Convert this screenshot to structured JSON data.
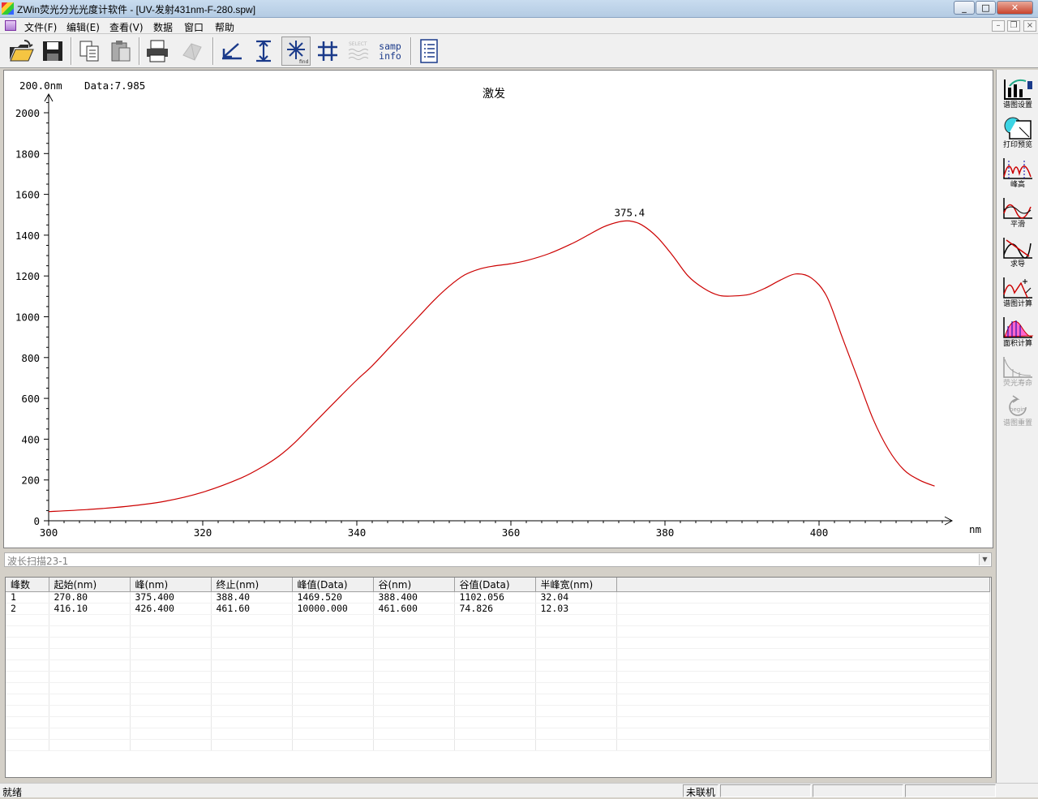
{
  "window": {
    "title": "ZWin荧光分光光度计软件 - [UV-发射431nm-F-280.spw]",
    "minimize": "_",
    "maximize": "□",
    "close": "✕"
  },
  "menubar": {
    "items": [
      "文件(F)",
      "编辑(E)",
      "查看(V)",
      "数据",
      "窗口",
      "帮助"
    ],
    "mdi_minimize": "–",
    "mdi_restore": "❐",
    "mdi_close": "×"
  },
  "toolbar": {
    "icons": [
      "open-folder-icon",
      "save-icon",
      "copy-icon",
      "paste-icon",
      "print-icon",
      "3d-view-icon",
      "undo-zoom-icon",
      "vertical-scale-icon",
      "peak-find-icon",
      "grid-icon",
      "select-icon",
      "samp-info-icon",
      "report-icon"
    ],
    "select_label": "SELECT",
    "samp_label": "samp",
    "info_label": "info",
    "find_label": "find"
  },
  "plot": {
    "cursor_text": "200.0nm",
    "data_text": "Data:7.985",
    "title": "激发",
    "x_unit": "nm",
    "peak_label": "375.4",
    "line_color": "#cc0000"
  },
  "chart_data": {
    "type": "line",
    "title": "激发",
    "xlabel": "nm",
    "ylabel": "",
    "xlim": [
      300,
      418
    ],
    "ylim": [
      0,
      2100
    ],
    "x_ticks": [
      300,
      320,
      340,
      360,
      380,
      400
    ],
    "y_ticks": [
      0,
      200,
      400,
      600,
      800,
      1000,
      1200,
      1400,
      1600,
      1800,
      2000
    ],
    "grid": false,
    "series": [
      {
        "x": [
          300,
          305,
          310,
          315,
          320,
          325,
          328,
          330,
          332,
          335,
          338,
          340,
          342,
          345,
          348,
          350,
          352,
          354,
          356,
          358,
          360,
          362,
          365,
          368,
          370,
          372,
          374,
          375.4,
          377,
          379,
          381,
          383,
          385,
          387,
          389,
          391,
          393,
          395,
          397,
          399,
          401,
          403,
          405,
          407,
          409,
          411,
          413,
          415
        ],
        "y": [
          45,
          55,
          70,
          95,
          140,
          210,
          270,
          320,
          385,
          500,
          615,
          690,
          760,
          880,
          1000,
          1080,
          1150,
          1205,
          1235,
          1250,
          1260,
          1275,
          1310,
          1360,
          1400,
          1440,
          1465,
          1469.5,
          1450,
          1390,
          1300,
          1200,
          1140,
          1105,
          1102,
          1110,
          1140,
          1180,
          1210,
          1190,
          1100,
          900,
          700,
          500,
          350,
          250,
          200,
          170
        ]
      }
    ],
    "annotations": [
      {
        "x": 375.4,
        "y": 1469.5,
        "text": "375.4"
      }
    ]
  },
  "right_panel": {
    "buttons": [
      {
        "label": "谱图设置",
        "icon": "spectrum-settings-icon",
        "enabled": true
      },
      {
        "label": "打印预览",
        "icon": "print-preview-icon",
        "enabled": true
      },
      {
        "label": "峰高",
        "icon": "peak-height-icon",
        "enabled": true
      },
      {
        "label": "平滑",
        "icon": "smooth-icon",
        "enabled": true
      },
      {
        "label": "求导",
        "icon": "derivative-icon",
        "enabled": true
      },
      {
        "label": "谱图计算",
        "icon": "spectrum-calc-icon",
        "enabled": true
      },
      {
        "label": "面积计算",
        "icon": "area-calc-icon",
        "enabled": true
      },
      {
        "label": "荧光寿命",
        "icon": "fluorescence-lifetime-icon",
        "enabled": false
      },
      {
        "label": "谱图重置",
        "icon": "spectrum-reset-icon",
        "enabled": false
      }
    ],
    "begin_label": "begin"
  },
  "combo": {
    "value": "波长扫描23-1"
  },
  "table": {
    "headers": [
      "峰数",
      "起始(nm)",
      "峰(nm)",
      "终止(nm)",
      "峰值(Data)",
      "谷(nm)",
      "谷值(Data)",
      "半峰宽(nm)"
    ],
    "rows": [
      [
        "1",
        "270.80",
        "375.400",
        "388.40",
        "1469.520",
        "388.400",
        "1102.056",
        "32.04"
      ],
      [
        "2",
        "416.10",
        "426.400",
        "461.60",
        "10000.000",
        "461.600",
        "74.826",
        "12.03"
      ]
    ]
  },
  "statusbar": {
    "ready": "就绪",
    "connection": "未联机"
  }
}
